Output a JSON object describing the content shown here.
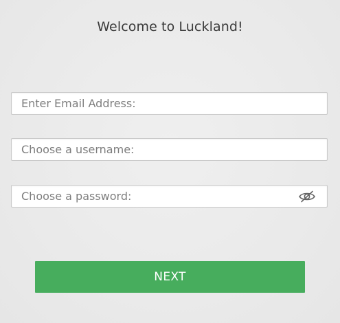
{
  "header": {
    "title": "Welcome to Luckland!"
  },
  "form": {
    "email": {
      "value": "",
      "placeholder": "Enter Email Address:"
    },
    "username": {
      "value": "",
      "placeholder": "Choose a username:"
    },
    "password": {
      "value": "",
      "placeholder": "Choose a password:",
      "toggle_icon": "eye-slash-icon"
    },
    "next_label": "NEXT"
  },
  "colors": {
    "background": "#ebebeb",
    "accent": "#47ad5d",
    "placeholder": "#7d7d7d",
    "title": "#3a3a3a"
  }
}
